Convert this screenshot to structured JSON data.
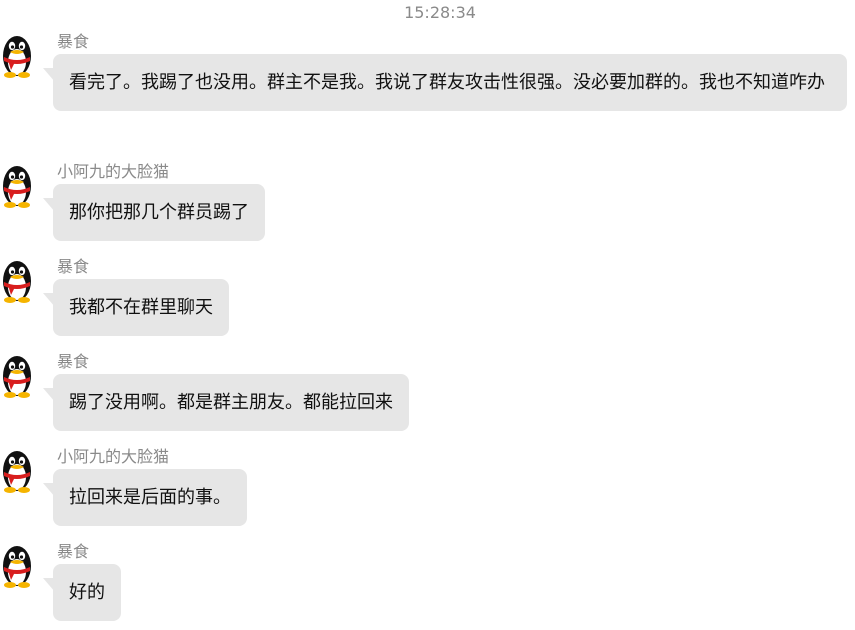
{
  "timestamp": "15:28:34",
  "icons": {
    "avatar": "qq-penguin-icon"
  },
  "colors": {
    "bubble": "#e6e6e6",
    "sender": "#8a8a8a",
    "timestamp": "#8a8a8a"
  },
  "messages": [
    {
      "sender": "暴食",
      "text": "看完了。我踢了也没用。群主不是我。我说了群友攻击性很强。没必要加群的。我也不知道咋办"
    },
    {
      "sender": "小阿九的大脸猫",
      "text": "那你把那几个群员踢了"
    },
    {
      "sender": "暴食",
      "text": "我都不在群里聊天"
    },
    {
      "sender": "暴食",
      "text": "踢了没用啊。都是群主朋友。都能拉回来"
    },
    {
      "sender": "小阿九的大脸猫",
      "text": "拉回来是后面的事。"
    },
    {
      "sender": "暴食",
      "text": "好的"
    }
  ]
}
